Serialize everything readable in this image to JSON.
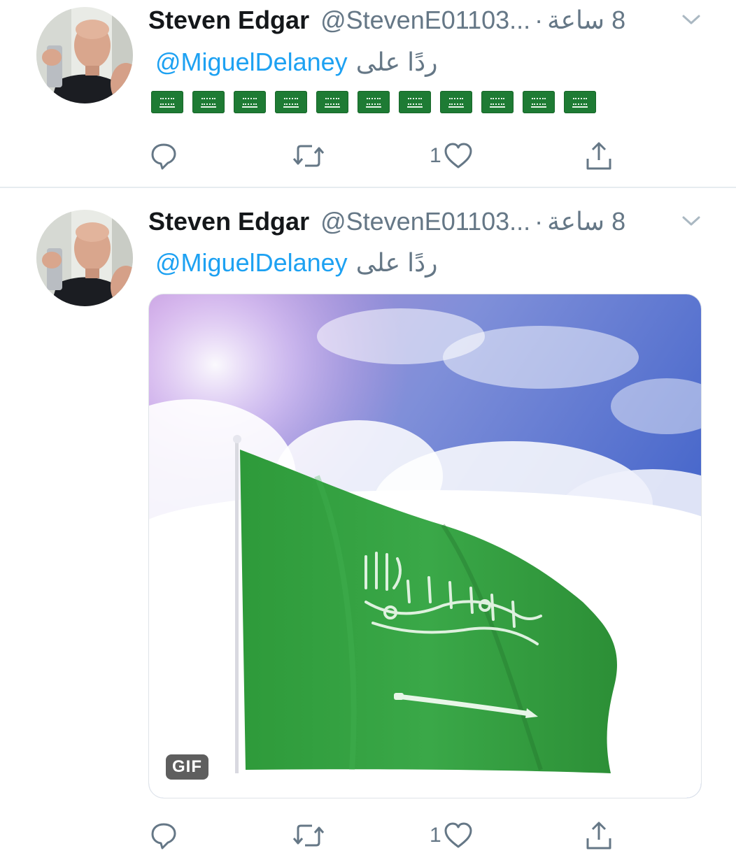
{
  "colors": {
    "link": "#1da1f2",
    "muted": "#657786",
    "text": "#14171a",
    "flag_green": "#1e7b34"
  },
  "tweets": [
    {
      "author_name": "Steven Edgar",
      "handle": "@StevenE01103...",
      "separator": "·",
      "time": "8 ساعة",
      "reply_label": "ردًا على",
      "reply_to": "@MiguelDelaney",
      "body_emoji": [
        "flag-sa",
        "flag-sa",
        "flag-sa",
        "flag-sa",
        "flag-sa",
        "flag-sa",
        "flag-sa",
        "flag-sa",
        "flag-sa",
        "flag-sa",
        "flag-sa"
      ],
      "actions": {
        "reply_icon": "reply-icon",
        "retweet_icon": "retweet-icon",
        "like_count": "1",
        "like_icon": "heart-icon",
        "share_icon": "share-icon"
      }
    },
    {
      "author_name": "Steven Edgar",
      "handle": "@StevenE01103...",
      "separator": "·",
      "time": "8 ساعة",
      "reply_label": "ردًا على",
      "reply_to": "@MiguelDelaney",
      "media": {
        "type": "gif",
        "badge": "GIF",
        "content": "saudi-flag-waving"
      },
      "actions": {
        "reply_icon": "reply-icon",
        "retweet_icon": "retweet-icon",
        "like_count": "1",
        "like_icon": "heart-icon",
        "share_icon": "share-icon"
      }
    }
  ]
}
